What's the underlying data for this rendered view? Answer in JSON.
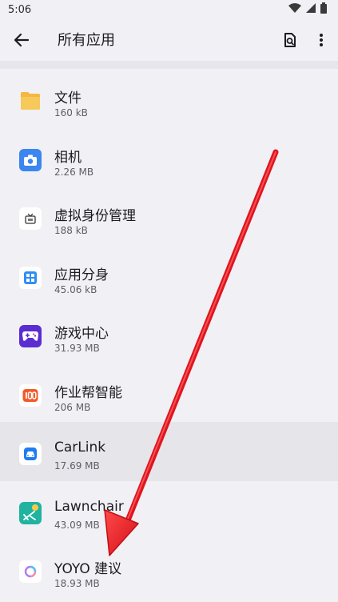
{
  "status_bar": {
    "time": "5:06",
    "icons": [
      "wifi-icon",
      "signal-icon",
      "battery-icon"
    ]
  },
  "app_bar": {
    "title": "所有应用",
    "back_icon": "arrow-left-icon",
    "search_icon": "app-search-icon",
    "menu_icon": "more-vert-icon"
  },
  "apps": [
    {
      "name": "文件",
      "size": "160 kB",
      "icon": "folder-icon"
    },
    {
      "name": "相机",
      "size": "2.26 MB",
      "icon": "camera-icon"
    },
    {
      "name": "虚拟身份管理",
      "size": "188 kB",
      "icon": "tv-icon"
    },
    {
      "name": "应用分身",
      "size": "45.06 kB",
      "icon": "app-clone-icon"
    },
    {
      "name": "游戏中心",
      "size": "31.93 MB",
      "icon": "gamepad-icon"
    },
    {
      "name": "作业帮智能",
      "size": "206 MB",
      "icon": "zyb-100-icon"
    },
    {
      "name": "CarLink",
      "size": "17.69 MB",
      "icon": "car-icon"
    },
    {
      "name": "Lawnchair",
      "size": "43.09 MB",
      "icon": "lawnchair-icon"
    },
    {
      "name": "YOYO 建议",
      "size": "18.93 MB",
      "icon": "yoyo-ring-icon"
    }
  ],
  "colors": {
    "background": "#f1f0f4",
    "highlight_row": "#e6e5ea",
    "annotation_arrow": "#e0141e"
  }
}
